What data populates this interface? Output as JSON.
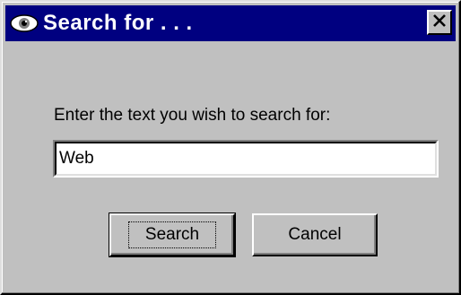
{
  "window": {
    "title": "Search for . . .",
    "title_icon": "eye-icon",
    "close_icon": "close-icon"
  },
  "form": {
    "prompt": "Enter the text you wish to search for:",
    "search_value": "Web"
  },
  "buttons": {
    "search_label": "Search",
    "cancel_label": "Cancel"
  },
  "colors": {
    "titlebar": "#000080",
    "face": "#c0c0c0"
  }
}
